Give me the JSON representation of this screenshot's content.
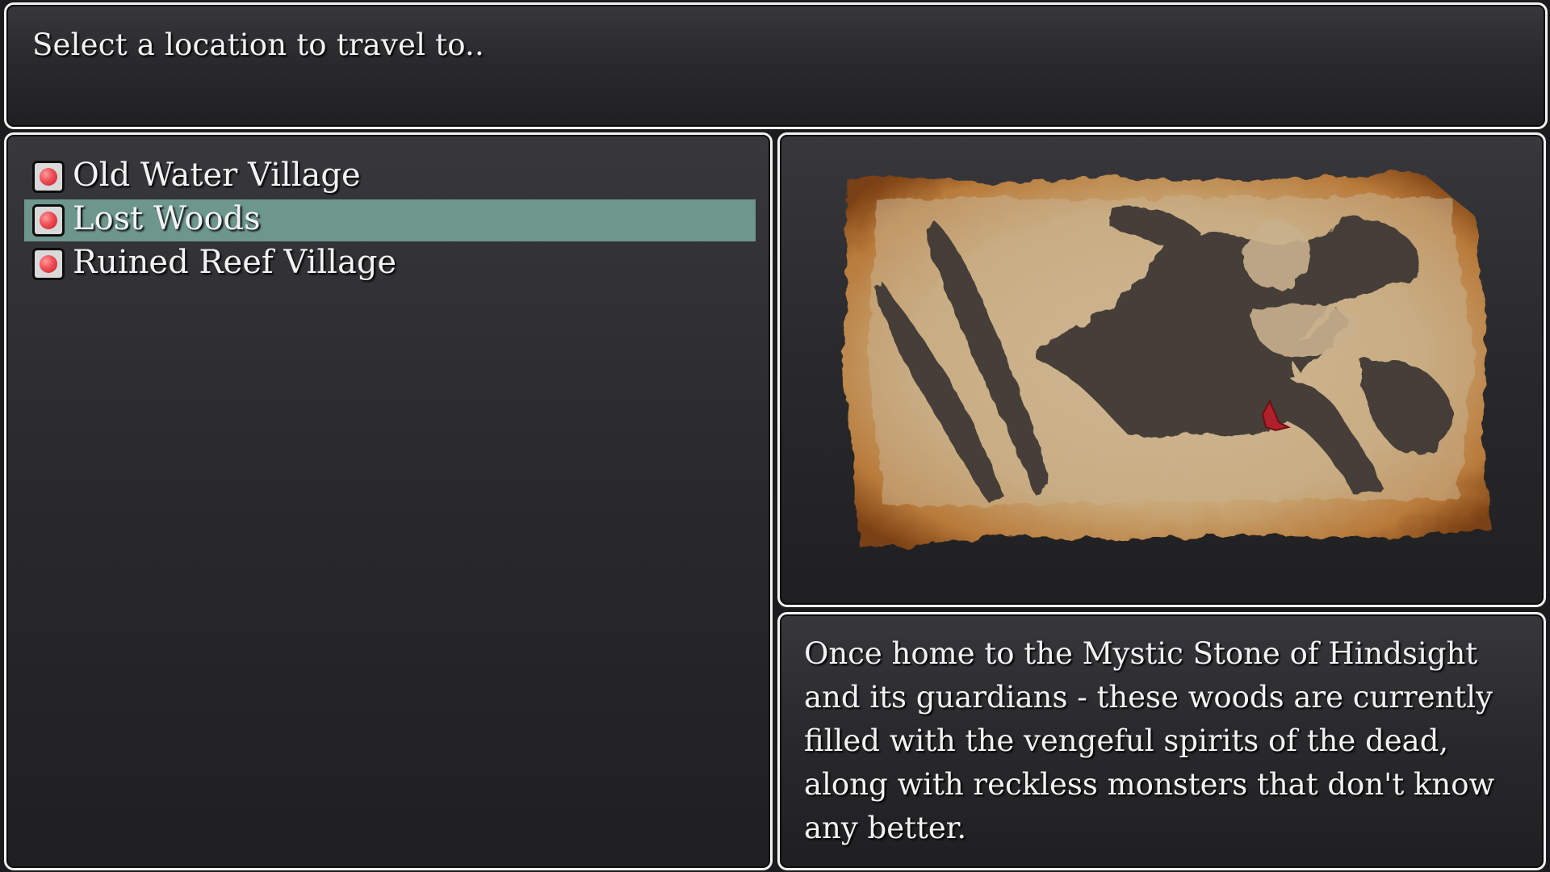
{
  "help": {
    "text": "Select a location to travel to.."
  },
  "locations": [
    {
      "label": "Old Water Village",
      "icon": "red-orb-icon",
      "selected": false
    },
    {
      "label": "Lost Woods",
      "icon": "red-orb-icon",
      "selected": true
    },
    {
      "label": "Ruined Reef Village",
      "icon": "red-orb-icon",
      "selected": false
    }
  ],
  "map": {
    "image": "parchment-world-map",
    "marker": "red-location-marker",
    "marker_color": "#b0202a"
  },
  "description": {
    "text": "Once home to the Mystic Stone of Hindsight and its guardians - these woods are currently filled with the vengeful spirits of the dead, along with reckless monsters that don't know any better."
  },
  "colors": {
    "selection": "#6d968c",
    "window_border": "#f0f0f0",
    "window_bg": "#2a2a2d"
  }
}
